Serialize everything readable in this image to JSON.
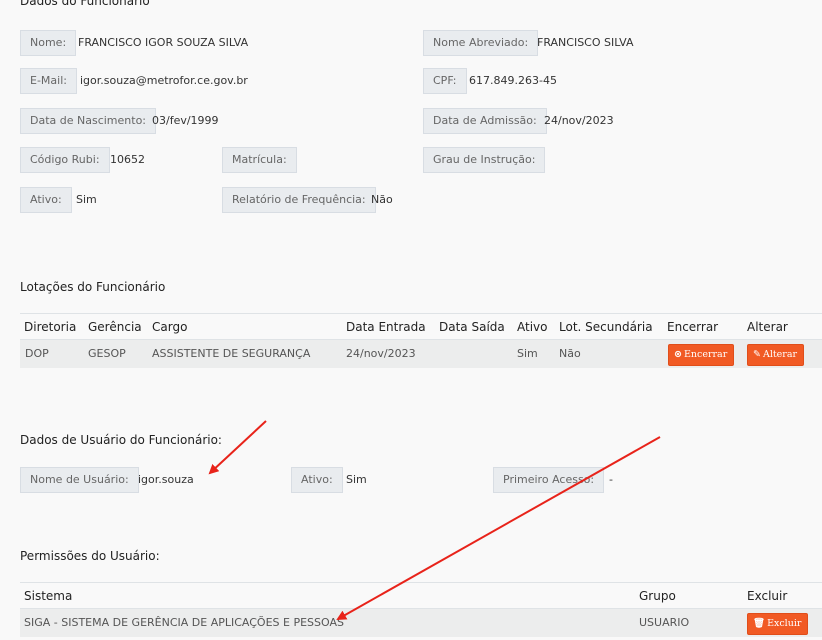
{
  "funcionario": {
    "section_title": "Dados do Funcionário",
    "nome_label": "Nome:",
    "nome": "FRANCISCO IGOR SOUZA SILVA",
    "nome_abreviado_label": "Nome Abreviado:",
    "nome_abreviado": "FRANCISCO SILVA",
    "email_label": "E-Mail:",
    "email": "igor.souza@metrofor.ce.gov.br",
    "cpf_label": "CPF:",
    "cpf": "617.849.263-45",
    "nascimento_label": "Data de Nascimento:",
    "nascimento": "03/fev/1999",
    "admissao_label": "Data de Admissão:",
    "admissao": "24/nov/2023",
    "codigo_rubi_label": "Código Rubi:",
    "codigo_rubi": "10652",
    "matricula_label": "Matrícula:",
    "grau_label": "Grau de Instrução:",
    "ativo_label": "Ativo:",
    "ativo": "Sim",
    "relatorio_label": "Relatório de Frequência:",
    "relatorio": "Não"
  },
  "lotacoes": {
    "section_title": "Lotações do Funcionário",
    "headers": [
      "Diretoria",
      "Gerência",
      "Cargo",
      "Data Entrada",
      "Data Saída",
      "Ativo",
      "Lot. Secundária",
      "Encerrar",
      "Alterar"
    ],
    "rows": [
      {
        "diretoria": "DOP",
        "gerencia": "GESOP",
        "cargo": "ASSISTENTE DE SEGURANÇA",
        "data_entrada": "24/nov/2023",
        "data_saida": "",
        "ativo": "Sim",
        "lot_secundaria": "Não",
        "encerrar_label": "Encerrar",
        "alterar_label": "Alterar"
      }
    ]
  },
  "usuario": {
    "section_title": "Dados de Usuário do Funcionário:",
    "nome_usuario_label": "Nome de Usuário:",
    "nome_usuario": "igor.souza",
    "ativo_label": "Ativo:",
    "ativo": "Sim",
    "primeiro_acesso_label": "Primeiro Acesso:",
    "primeiro_acesso": "-"
  },
  "permissoes": {
    "section_title": "Permissões do Usuário:",
    "headers": [
      "Sistema",
      "Grupo",
      "Excluir"
    ],
    "rows": [
      {
        "sistema": "SIGA - SISTEMA DE GERÊNCIA DE APLICAÇÕES E PESSOAS",
        "grupo": "USUARIO",
        "excluir_label": "Excluir"
      }
    ]
  },
  "colors": {
    "button": "#f15a24",
    "label_bg": "#e9ecef",
    "annotation_arrow": "#e8231a"
  }
}
